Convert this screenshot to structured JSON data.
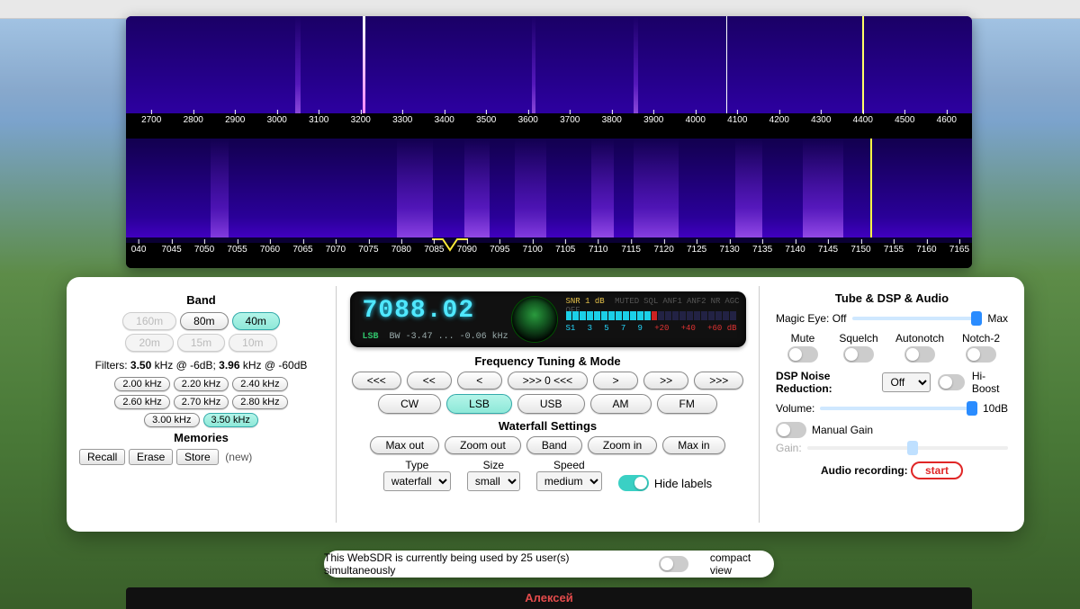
{
  "ruler_top": [
    "2700",
    "2800",
    "2900",
    "3000",
    "3100",
    "3200",
    "3300",
    "3400",
    "3500",
    "3600",
    "3700",
    "3800",
    "3900",
    "4000",
    "4100",
    "4200",
    "4300",
    "4400",
    "4500",
    "4600"
  ],
  "ruler_bot": [
    "040",
    "7045",
    "7050",
    "7055",
    "7060",
    "7065",
    "7070",
    "7075",
    "7080",
    "7085",
    "7090",
    "7095",
    "7100",
    "7105",
    "7110",
    "7115",
    "7120",
    "7125",
    "7130",
    "7135",
    "7140",
    "7145",
    "7150",
    "7155",
    "7160",
    "7165"
  ],
  "band": {
    "title": "Band",
    "b160": "160m",
    "b80": "80m",
    "b40": "40m",
    "b20": "20m",
    "b15": "15m",
    "b10": "10m"
  },
  "filters": {
    "label_a": "Filters:",
    "v1": "3.50",
    "u1": "kHz @ -6dB;",
    "v2": "3.96",
    "u2": "kHz @ -60dB",
    "opts": [
      "2.00 kHz",
      "2.20 kHz",
      "2.40 kHz",
      "2.60 kHz",
      "2.70 kHz",
      "2.80 kHz",
      "3.00 kHz",
      "3.50 kHz"
    ]
  },
  "memories": {
    "title": "Memories",
    "recall": "Recall",
    "erase": "Erase",
    "store": "Store",
    "note": "(new)"
  },
  "display": {
    "freq": "7088.02",
    "mode": "LSB",
    "bw_label": "BW",
    "bw_range": "-3.47 ... -0.06 kHz",
    "snr_label": "SNR",
    "snr_val": "1 dB",
    "flags": [
      "MUTED",
      "SQL",
      "ANF1",
      "ANF2",
      "NR",
      "AGC OFF"
    ],
    "s_scale": [
      "S1",
      "3",
      "5",
      "7",
      "9",
      "+20",
      "+40",
      "+60 dB"
    ]
  },
  "tuning": {
    "title": "Frequency Tuning & Mode",
    "nav": [
      "<<<",
      "<<",
      "<",
      ">>> 0 <<<",
      ">",
      ">>",
      ">>>"
    ],
    "modes": [
      "CW",
      "LSB",
      "USB",
      "AM",
      "FM"
    ]
  },
  "wfset": {
    "title": "Waterfall Settings",
    "zoom": [
      "Max out",
      "Zoom out",
      "Band",
      "Zoom in",
      "Max in"
    ],
    "type_label": "Type",
    "type_sel": "waterfall",
    "size_label": "Size",
    "size_sel": "small",
    "speed_label": "Speed",
    "speed_sel": "medium",
    "hide": "Hide labels"
  },
  "dsp": {
    "title": "Tube & DSP & Audio",
    "magic_eye": "Magic Eye:",
    "off": "Off",
    "max": "Max",
    "mute": "Mute",
    "squelch": "Squelch",
    "autonotch": "Autonotch",
    "notch2": "Notch-2",
    "dnr": "DSP Noise Reduction:",
    "dnr_sel": "Off",
    "hiboost": "Hi-Boost",
    "volume": "Volume:",
    "vol_val": "10dB",
    "manual_gain": "Manual Gain",
    "gain": "Gain:",
    "rec": "Audio recording:",
    "start": "start"
  },
  "bottom": {
    "msg": "This WebSDR is currently being used by 25 user(s) simultaneously",
    "compact": "compact view"
  },
  "name": "Алексей"
}
